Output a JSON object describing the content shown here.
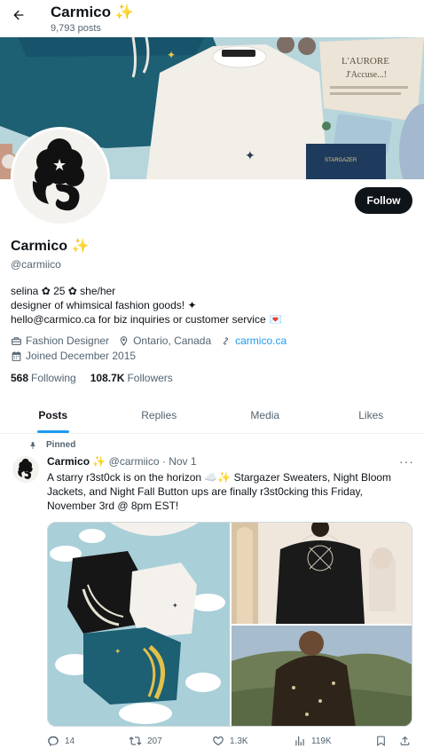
{
  "header": {
    "title": "Carmico ✨",
    "subtitle": "9,793 posts"
  },
  "profile": {
    "name": "Carmico ✨",
    "handle": "@carmiico",
    "follow_label": "Follow",
    "bio": [
      "selina ✿ 25 ✿ she/her",
      "designer of whimsical fashion goods! ✦",
      "hello@carmico.ca for biz inquiries or customer service 💌"
    ],
    "category": "Fashion Designer",
    "location": "Ontario, Canada",
    "website": "carmico.ca",
    "joined": "Joined December 2015",
    "following_count": "568",
    "following_label": "Following",
    "followers_count": "108.7K",
    "followers_label": "Followers"
  },
  "tabs": [
    {
      "label": "Posts",
      "active": true
    },
    {
      "label": "Replies",
      "active": false
    },
    {
      "label": "Media",
      "active": false
    },
    {
      "label": "Likes",
      "active": false
    }
  ],
  "post": {
    "pinned_label": "Pinned",
    "author": "Carmico ✨",
    "handle": "@carmiico",
    "separator": "·",
    "date": "Nov 1",
    "text": [
      "A starry r3st0ck is on the horizon ☁️✨ Stargazer Sweaters, Night Bloom",
      "Jackets, and Night Fall Button ups are finally r3st0cking this Friday,",
      "November 3rd @ 8pm EST!"
    ],
    "replies": "14",
    "reposts": "207",
    "likes": "1.3K",
    "views": "119K"
  },
  "colors": {
    "accent": "#1d9bf0",
    "text": "#0f1419",
    "muted": "#536471",
    "button": "#0f1419"
  },
  "icons": [
    "back-arrow-icon",
    "briefcase-icon",
    "location-pin-icon",
    "link-icon",
    "calendar-icon",
    "pin-icon",
    "more-icon",
    "reply-icon",
    "repost-icon",
    "like-icon",
    "views-icon",
    "bookmark-icon",
    "share-icon"
  ]
}
